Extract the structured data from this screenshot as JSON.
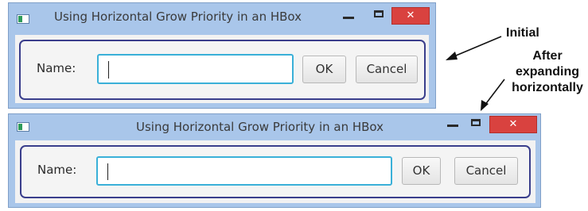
{
  "window_initial": {
    "title": "Using Horizontal Grow Priority in an HBox",
    "name_label": "Name:",
    "name_value": "",
    "ok_label": "OK",
    "cancel_label": "Cancel",
    "close_glyph": "✕"
  },
  "window_expanded": {
    "title": "Using Horizontal Grow Priority in an HBox",
    "name_label": "Name:",
    "name_value": "",
    "ok_label": "OK",
    "cancel_label": "Cancel",
    "close_glyph": "✕"
  },
  "annotations": {
    "initial": "Initial",
    "after_line1": "After",
    "after_line2": "expanding",
    "after_line3": "horizontally"
  },
  "colors": {
    "titlebar": "#a9c6ea",
    "close_button": "#d9423f",
    "hbox_border": "#3a3e8c",
    "focus_border": "#3ab0d8"
  }
}
